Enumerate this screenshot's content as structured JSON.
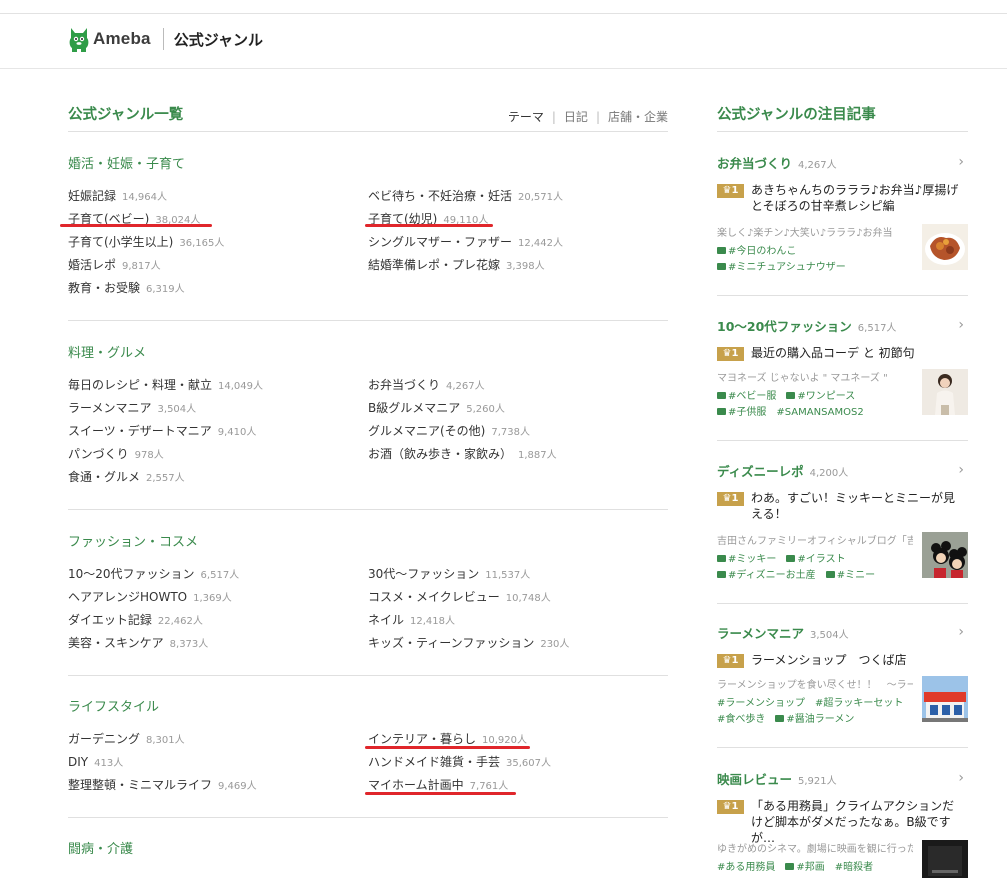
{
  "header": {
    "logo_text": "Ameba",
    "subtitle": "公式ジャンル"
  },
  "left": {
    "title": "公式ジャンル一覧",
    "tabs": [
      {
        "label": "テーマ",
        "active": true
      },
      {
        "label": "日記",
        "active": false
      },
      {
        "label": "店舗・企業",
        "active": false
      }
    ],
    "genres": [
      {
        "name": "婚活・妊娠・子育て",
        "items": [
          {
            "label": "妊娠記録",
            "count": "14,964人"
          },
          {
            "label": "ベビ待ち・不妊治療・妊活",
            "count": "20,571人"
          },
          {
            "label": "子育て(ベビー)",
            "count": "38,024人"
          },
          {
            "label": "子育て(幼児)",
            "count": "49,110人"
          },
          {
            "label": "子育て(小学生以上)",
            "count": "36,165人"
          },
          {
            "label": "シングルマザー・ファザー",
            "count": "12,442人"
          },
          {
            "label": "婚活レポ",
            "count": "9,817人"
          },
          {
            "label": "結婚準備レポ・プレ花嫁",
            "count": "3,398人"
          },
          {
            "label": "教育・お受験",
            "count": "6,319人"
          }
        ]
      },
      {
        "name": "料理・グルメ",
        "items": [
          {
            "label": "毎日のレシピ・料理・献立",
            "count": "14,049人"
          },
          {
            "label": "お弁当づくり",
            "count": "4,267人"
          },
          {
            "label": "ラーメンマニア",
            "count": "3,504人"
          },
          {
            "label": "B級グルメマニア",
            "count": "5,260人"
          },
          {
            "label": "スイーツ・デザートマニア",
            "count": "9,410人"
          },
          {
            "label": "グルメマニア(その他)",
            "count": "7,738人"
          },
          {
            "label": "パンづくり",
            "count": "978人"
          },
          {
            "label": "お酒（飲み歩き・家飲み）",
            "count": "1,887人"
          },
          {
            "label": "食通・グルメ",
            "count": "2,557人"
          }
        ]
      },
      {
        "name": "ファッション・コスメ",
        "items": [
          {
            "label": "10〜20代ファッション",
            "count": "6,517人"
          },
          {
            "label": "30代〜ファッション",
            "count": "11,537人"
          },
          {
            "label": "ヘアアレンジHOWTO",
            "count": "1,369人"
          },
          {
            "label": "コスメ・メイクレビュー",
            "count": "10,748人"
          },
          {
            "label": "ダイエット記録",
            "count": "22,462人"
          },
          {
            "label": "ネイル",
            "count": "12,418人"
          },
          {
            "label": "美容・スキンケア",
            "count": "8,373人"
          },
          {
            "label": "キッズ・ティーンファッション",
            "count": "230人"
          }
        ]
      },
      {
        "name": "ライフスタイル",
        "items": [
          {
            "label": "ガーデニング",
            "count": "8,301人"
          },
          {
            "label": "インテリア・暮らし",
            "count": "10,920人"
          },
          {
            "label": "DIY",
            "count": "413人"
          },
          {
            "label": "ハンドメイド雑貨・手芸",
            "count": "35,607人"
          },
          {
            "label": "整理整頓・ミニマルライフ",
            "count": "9,469人"
          },
          {
            "label": "マイホーム計画中",
            "count": "7,761人"
          }
        ]
      },
      {
        "name": "闘病・介護",
        "items": []
      }
    ]
  },
  "right": {
    "title": "公式ジャンルの注目記事",
    "cards": [
      {
        "genre": "お弁当づくり",
        "count": "4,267人",
        "rank": "1",
        "article": "あきちゃんちのラララ♪お弁当♪厚揚げとそぼろの甘辛煮レシピ編",
        "snippet": "楽しく♪楽チン♪大笑い♪ラララ♪お弁当",
        "tags": [
          [
            "#今日のわんこ"
          ],
          [
            "#ミニチュアシュナウザー"
          ]
        ],
        "thumb_color": "#b5542a"
      },
      {
        "genre": "10〜20代ファッション",
        "count": "6,517人",
        "rank": "1",
        "article": "最近の購入品コーデ と 初節句",
        "snippet": "マヨネーズ じゃないよ \" マユネーズ \"",
        "tags": [
          [
            "#ベビー服",
            "#ワンピース"
          ],
          [
            "#子供服",
            "#SAMANSAMOS2"
          ]
        ],
        "thumb_color": "#e9e2d8"
      },
      {
        "genre": "ディズニーレポ",
        "count": "4,200人",
        "rank": "1",
        "article": "わあ。すごい！ミッキーとミニーが見える！",
        "snippet": "吉田さんファミリーオフィシャルブログ「吉田",
        "tags": [
          [
            "#ミッキー",
            "#イラスト"
          ],
          [
            "#ディズニーお土産",
            "#ミニー"
          ]
        ],
        "thumb_color": "#8a8f86"
      },
      {
        "genre": "ラーメンマニア",
        "count": "3,504人",
        "rank": "1",
        "article": "ラーメンショップ　つくば店",
        "snippet": "ラーメンショップを食い尽くせ！！　〜ラー",
        "tags": [
          [
            "#ラーメンショップ",
            "#超ラッキーセット"
          ],
          [
            "#食べ歩き",
            "#醤油ラーメン"
          ]
        ],
        "thumb_color": "#3f6db3"
      },
      {
        "genre": "映画レビュー",
        "count": "5,921人",
        "rank": "1",
        "article": "「ある用務員」クライムアクションだけど脚本がダメだったなぁ。B級ですが…",
        "snippet": "ゆきがめのシネマ。劇場に映画を観に行った",
        "tags": [
          [
            "#ある用務員",
            "#邦画",
            "#暗殺者"
          ]
        ],
        "thumb_color": "#222222"
      }
    ]
  }
}
